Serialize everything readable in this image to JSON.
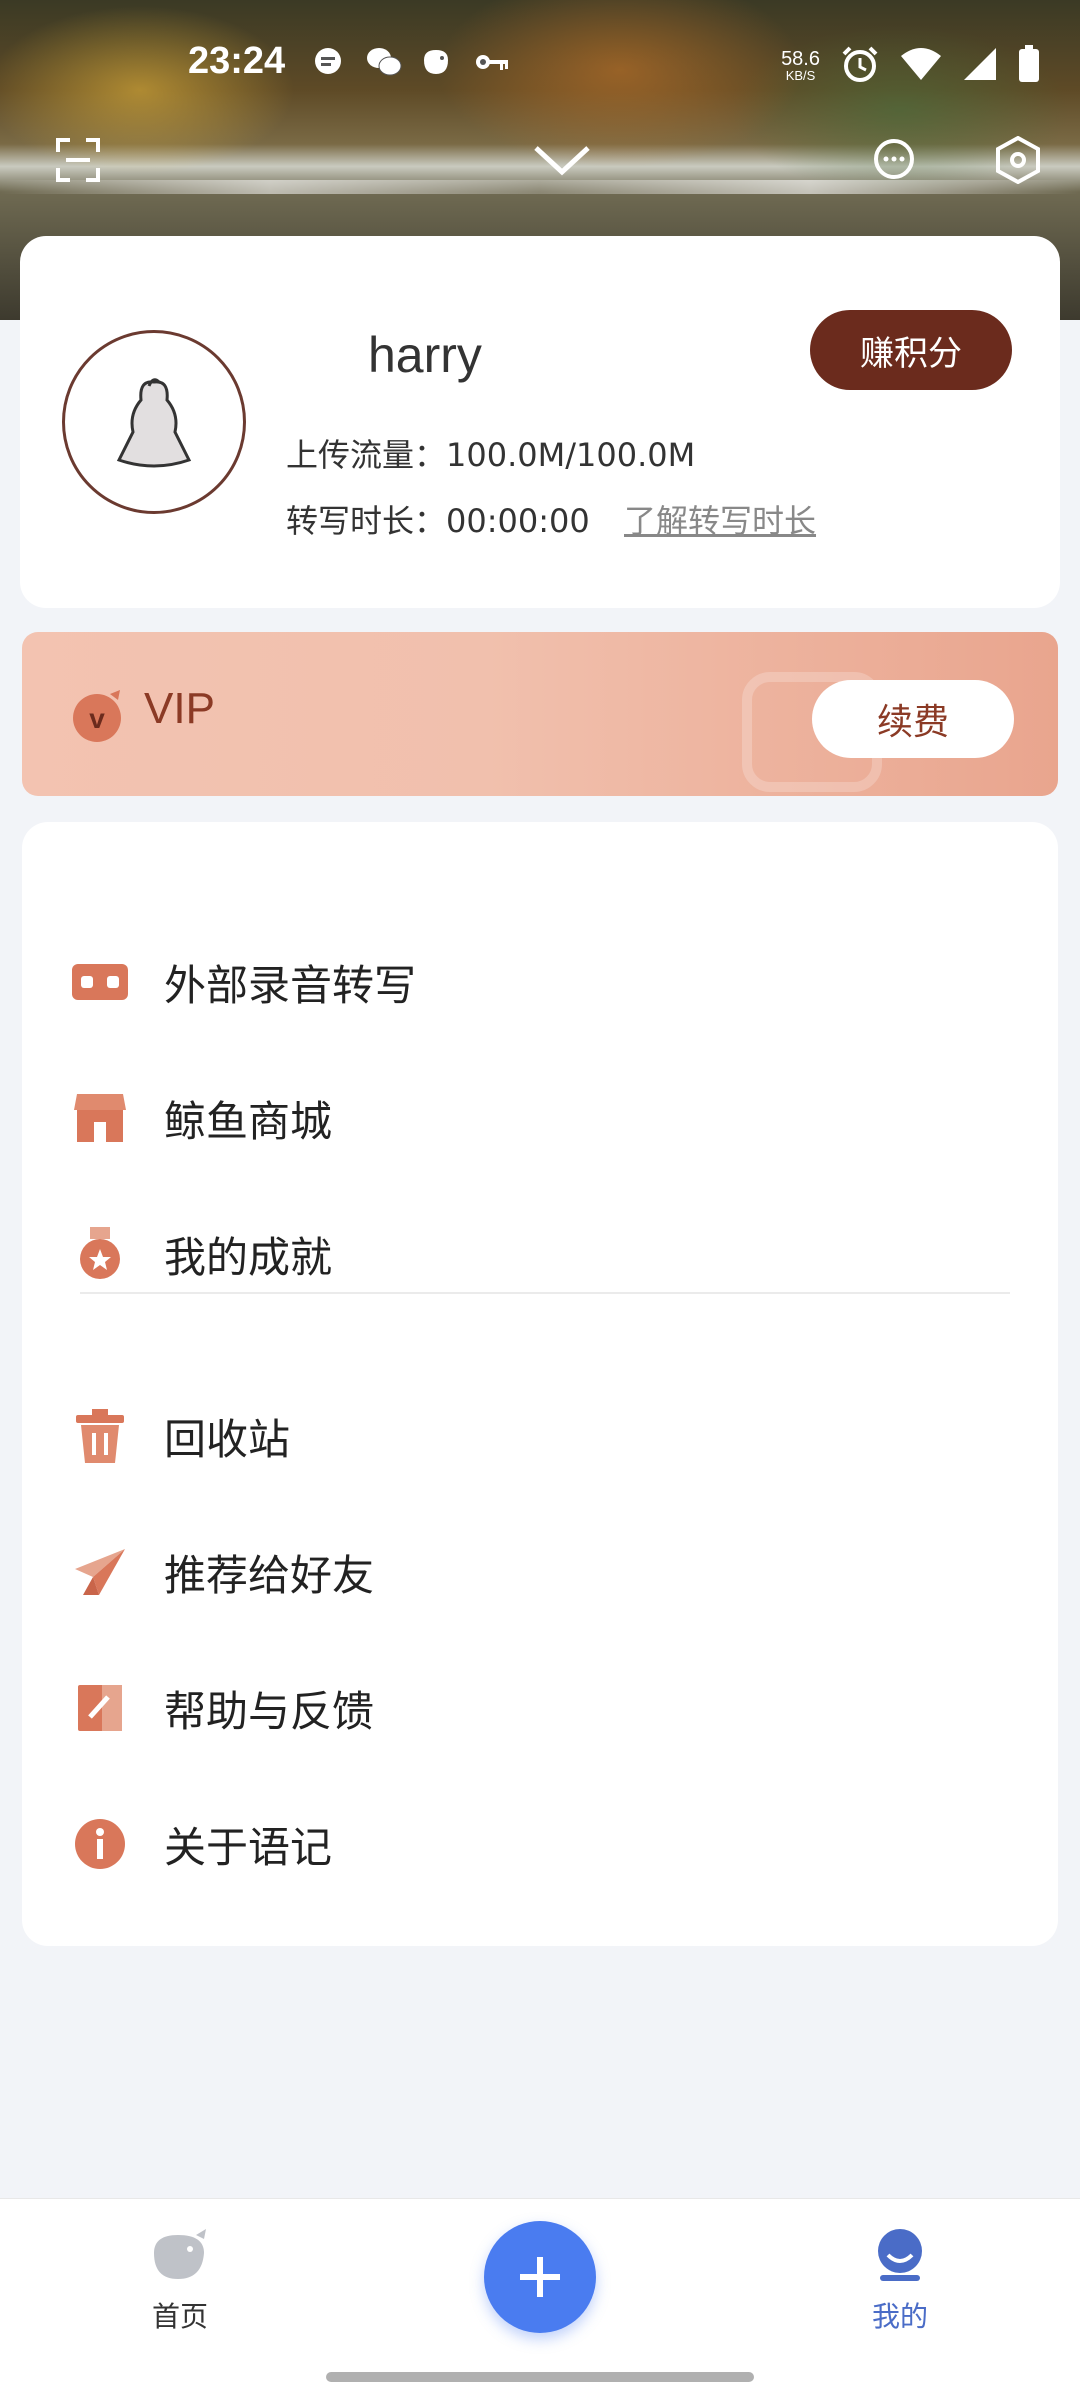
{
  "status_bar": {
    "time": "23:24",
    "net_speed": "58.6",
    "net_speed_unit": "KB/S",
    "notification_icons": [
      "message-icon",
      "wechat-icon",
      "whale-icon",
      "key-icon"
    ],
    "right_icons": [
      "alarm-icon",
      "wifi-icon",
      "signal-icon",
      "battery-icon"
    ]
  },
  "top_actions": {
    "scan_icon": "scan-icon",
    "collapse_icon": "chevron-down-icon",
    "message_icon": "chat-icon",
    "settings_icon": "settings-icon"
  },
  "profile": {
    "username": "harry",
    "earn_points_label": "赚积分",
    "upload_traffic_label": "上传流量：",
    "upload_traffic_value": "100.0M/100.0M",
    "transcription_label": "转写时长：",
    "transcription_value": "00:00:00",
    "learn_more_label": "了解转写时长"
  },
  "vip": {
    "label": "VIP",
    "renew_label": "续费"
  },
  "menu": {
    "items": [
      {
        "label": "外部录音转写",
        "icon": "recorder-icon"
      },
      {
        "label": "鲸鱼商城",
        "icon": "store-icon"
      },
      {
        "label": "我的成就",
        "icon": "medal-icon"
      },
      {
        "label": "回收站",
        "icon": "trash-icon"
      },
      {
        "label": "推荐给好友",
        "icon": "paper-plane-icon"
      },
      {
        "label": "帮助与反馈",
        "icon": "edit-icon"
      },
      {
        "label": "关于语记",
        "icon": "info-icon"
      }
    ]
  },
  "bottom_nav": {
    "home_label": "首页",
    "mine_label": "我的",
    "active": "mine"
  },
  "colors": {
    "accent_brown": "#6b2b1d",
    "vip_text": "#8b3a25",
    "icon_copper": "#d9775a",
    "fab_blue": "#4a7cf0",
    "nav_active": "#4a6cc7"
  }
}
